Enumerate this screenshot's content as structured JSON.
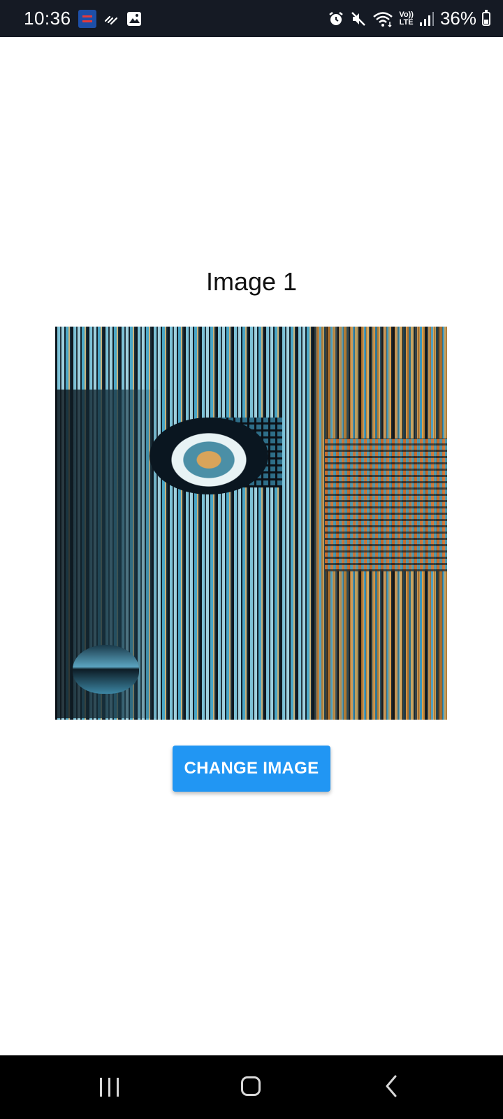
{
  "status_bar": {
    "time": "10:36",
    "battery": "36%",
    "lte_top": "Vo))",
    "lte_bottom": "LTE",
    "icons": [
      "app-notification-icon",
      "missed-call-icon",
      "gallery-icon",
      "alarm-icon",
      "mute-icon",
      "wifi-icon",
      "volte-icon",
      "signal-icon",
      "battery-icon"
    ],
    "battery_level": 0.36
  },
  "main": {
    "title": "Image 1",
    "image_alt": "abstract digital portrait artwork",
    "button_label": "CHANGE IMAGE",
    "button_color": "#2196f3"
  },
  "nav_bar": {
    "icons": [
      "recent-apps-icon",
      "home-icon",
      "back-icon"
    ]
  }
}
